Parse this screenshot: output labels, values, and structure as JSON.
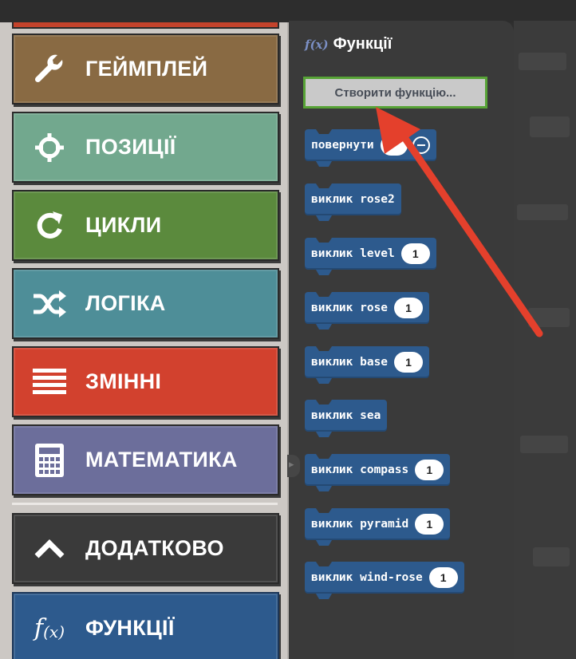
{
  "categories": [
    {
      "label": "ГЕЙМПЛЕЙ",
      "icon": "wrench-icon",
      "color": "#896a43"
    },
    {
      "label": "ПОЗИЦІЇ",
      "icon": "crosshair-icon",
      "color": "#72a88e"
    },
    {
      "label": "ЦИКЛИ",
      "icon": "loop-icon",
      "color": "#5b8a3d"
    },
    {
      "label": "ЛОГІКА",
      "icon": "shuffle-icon",
      "color": "#4e8e98"
    },
    {
      "label": "ЗМІННІ",
      "icon": "list-icon",
      "color": "#d2412e"
    },
    {
      "label": "МАТЕМАТИКА",
      "icon": "calculator-icon",
      "color": "#6c6e9b"
    },
    {
      "label": "ДОДАТКОВО",
      "icon": "chevron-up-icon",
      "color": "#3a3a3a"
    },
    {
      "label": "ФУНКЦІЇ",
      "icon": "function-icon",
      "color": "#2d5a8d"
    }
  ],
  "flyout": {
    "title": "Функції",
    "title_icon": "f(x)",
    "create_button": "Створити функцію...",
    "blocks": [
      {
        "text": "повернути",
        "pill": "",
        "has_minus": true
      },
      {
        "text": "виклик rose2",
        "pill": null
      },
      {
        "text": "виклик level",
        "pill": "1"
      },
      {
        "text": "виклик rose",
        "pill": "1"
      },
      {
        "text": "виклик base",
        "pill": "1"
      },
      {
        "text": "виклик sea",
        "pill": null
      },
      {
        "text": "виклик compass",
        "pill": "1"
      },
      {
        "text": "виклик pyramid",
        "pill": "1"
      },
      {
        "text": "виклик wind-rose",
        "pill": "1"
      }
    ]
  },
  "fx_glyph": {
    "f": "f",
    "x": "(x)"
  },
  "colors": {
    "accent_arrow": "#e4402c",
    "create_border": "#57a336",
    "block_blue": "#2d5a8d"
  }
}
